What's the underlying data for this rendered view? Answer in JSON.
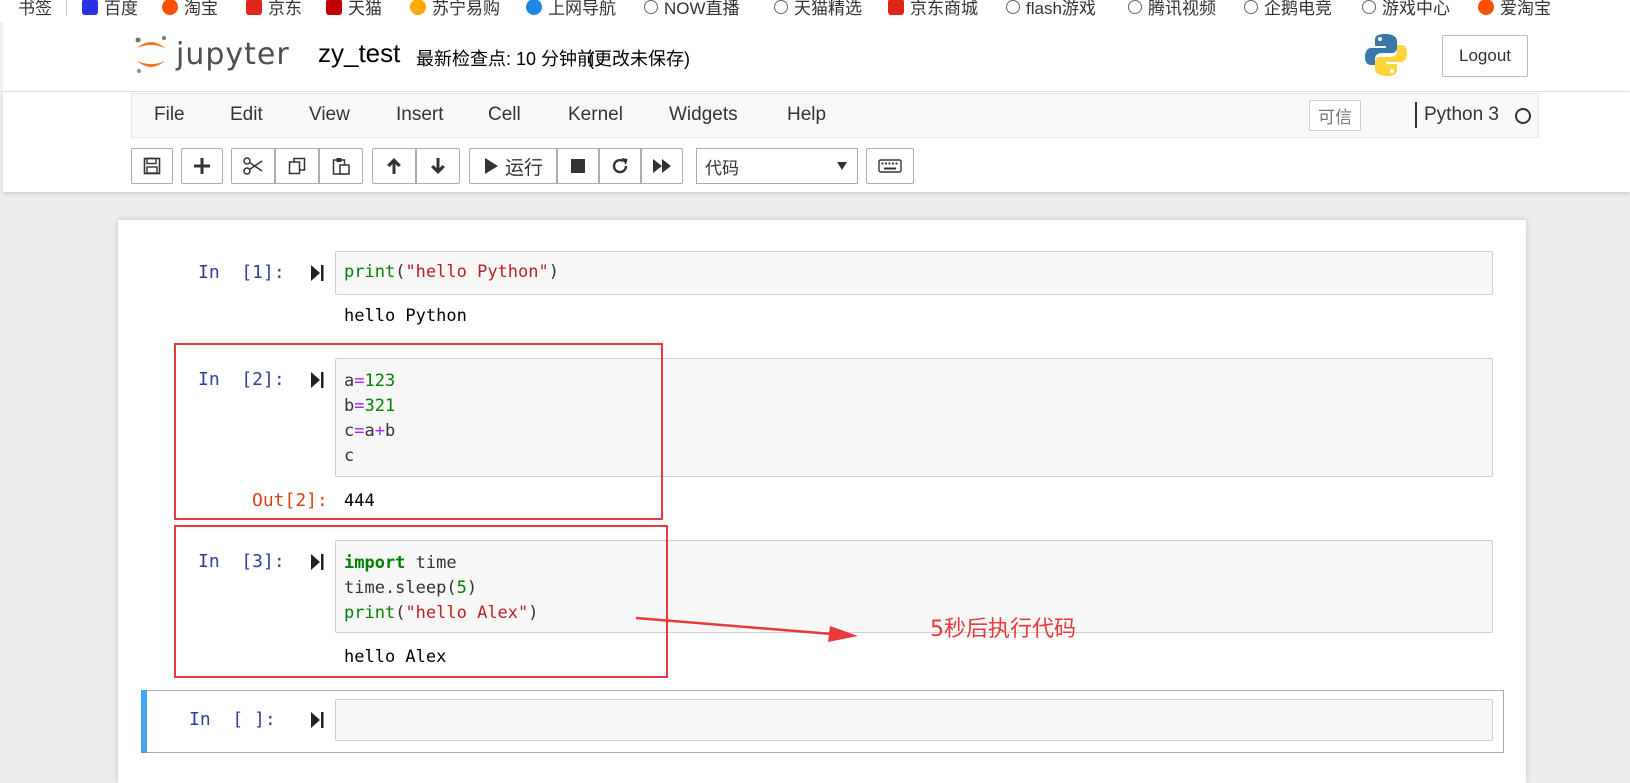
{
  "bookmarks": [
    {
      "label": "书签",
      "icon": "none"
    },
    {
      "label": "百度",
      "icon": "baidu-icon"
    },
    {
      "label": "淘宝",
      "icon": "taobao-icon"
    },
    {
      "label": "京东",
      "icon": "jd-icon"
    },
    {
      "label": "天猫",
      "icon": "tmall-icon"
    },
    {
      "label": "苏宁易购",
      "icon": "suning-icon"
    },
    {
      "label": "上网导航",
      "icon": "ie-icon"
    },
    {
      "label": "NOW直播",
      "icon": "globe-icon"
    },
    {
      "label": "天猫精选",
      "icon": "globe-icon"
    },
    {
      "label": "京东商城",
      "icon": "jd-icon"
    },
    {
      "label": "flash游戏",
      "icon": "globe-icon"
    },
    {
      "label": "腾讯视频",
      "icon": "globe-icon"
    },
    {
      "label": "企鹅电竞",
      "icon": "globe-icon"
    },
    {
      "label": "游戏中心",
      "icon": "globe-icon"
    },
    {
      "label": "爱淘宝",
      "icon": "taobao-icon"
    }
  ],
  "header": {
    "logo_text": "jupyter",
    "notebook_name": "zy_test",
    "checkpoint": "最新检查点: 10 分钟前",
    "autosave_status": "(更改未保存)",
    "logout_label": "Logout"
  },
  "menubar": {
    "items": [
      "File",
      "Edit",
      "View",
      "Insert",
      "Cell",
      "Kernel",
      "Widgets",
      "Help"
    ],
    "trusted_label": "可信",
    "kernel_name": "Python 3"
  },
  "toolbar": {
    "run_label": "运行",
    "cell_type": "代码"
  },
  "cells": [
    {
      "in_prompt": "In  [1]:",
      "code": "print(\"hello Python\")",
      "output": "hello Python"
    },
    {
      "in_prompt": "In  [2]:",
      "code_lines": [
        "a=123",
        "b=321",
        "c=a+b",
        "c"
      ],
      "out_prompt": "Out[2]:",
      "output": "444"
    },
    {
      "in_prompt": "In  [3]:",
      "code_lines": [
        "import time",
        "time.sleep(5)",
        "print(\"hello Alex\")"
      ],
      "output": "hello Alex"
    },
    {
      "in_prompt": "In  [ ]:"
    }
  ],
  "annotation": {
    "text": "5秒后执行代码",
    "color": "#e83a3a"
  },
  "colors": {
    "in_prompt": "#303f9f",
    "out_prompt": "#d84315",
    "selected_cell_bar": "#42a5f5"
  }
}
